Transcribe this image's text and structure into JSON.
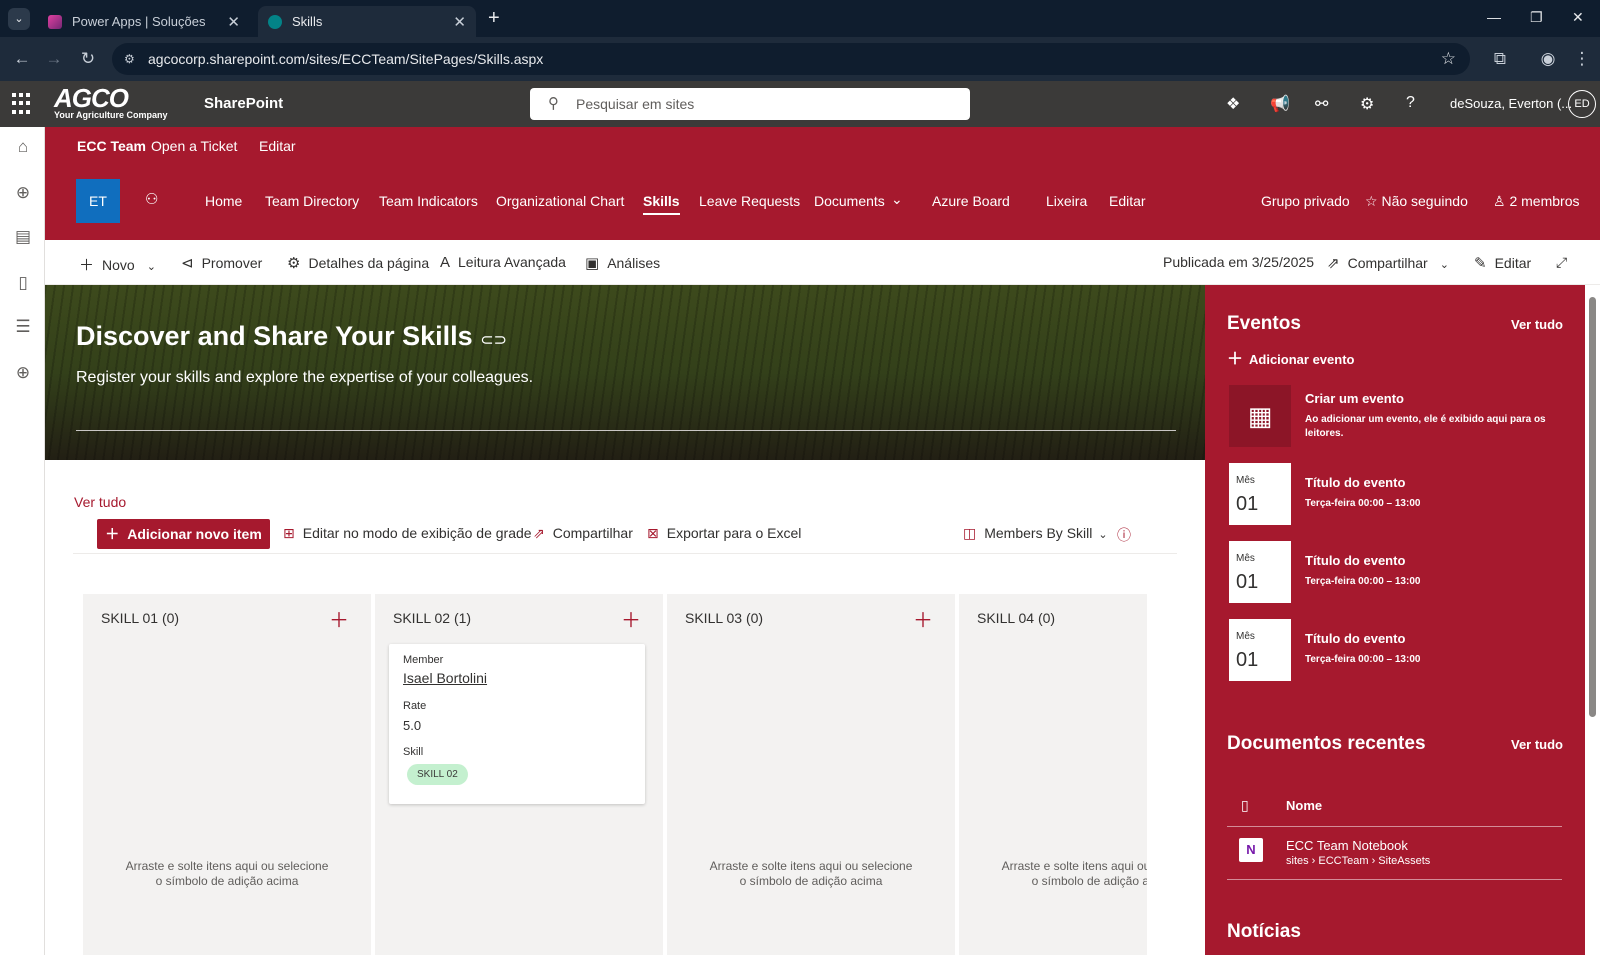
{
  "browser": {
    "tabs": [
      {
        "title": "Power Apps | Soluções",
        "active": false
      },
      {
        "title": "Skills",
        "active": true
      }
    ],
    "url": "agcocorp.sharepoint.com/sites/ECCTeam/SitePages/Skills.aspx"
  },
  "suite": {
    "logo": "AGCO",
    "tagline": "Your Agriculture Company",
    "app": "SharePoint",
    "search_placeholder": "Pesquisar em sites",
    "user": "deSouza, Everton (...",
    "initials": "ED"
  },
  "hub": {
    "items": [
      "ECC Team",
      "Open a Ticket",
      "Editar"
    ]
  },
  "site": {
    "initials": "ET",
    "nav": [
      "Home",
      "Team Directory",
      "Team Indicators",
      "Organizational Chart",
      "Skills",
      "Leave Requests",
      "Documents",
      "Azure Board",
      "Lixeira",
      "Editar"
    ],
    "current": "Skills",
    "privacy": "Grupo privado",
    "follow": "Não seguindo",
    "members": "2 membros"
  },
  "commandbar": {
    "new": "Novo",
    "promote": "Promover",
    "details": "Detalhes da página",
    "reader": "Leitura Avançada",
    "analytics": "Análises",
    "published": "Publicada em 3/25/2025",
    "share": "Compartilhar",
    "edit": "Editar"
  },
  "hero": {
    "title": "Discover and Share Your Skills",
    "subtitle": "Register your skills and explore the expertise of your colleagues."
  },
  "list": {
    "see_all": "Ver tudo",
    "add_item": "Adicionar novo item",
    "grid_edit": "Editar no modo de exibição de grade",
    "share": "Compartilhar",
    "export": "Exportar para o Excel",
    "view": "Members By Skill",
    "empty_text": "Arraste e solte itens aqui ou selecione o símbolo de adição acima",
    "columns": [
      {
        "title": "SKILL 01 (0)",
        "cards": []
      },
      {
        "title": "SKILL 02 (1)",
        "cards": [
          {
            "member_label": "Member",
            "member": "Isael Bortolini",
            "rate_label": "Rate",
            "rate": "5.0",
            "skill_label": "Skill",
            "skill": "SKILL 02"
          }
        ]
      },
      {
        "title": "SKILL 03 (0)",
        "cards": []
      },
      {
        "title": "SKILL 04 (0)",
        "cards": []
      }
    ]
  },
  "events": {
    "title": "Eventos",
    "see_all": "Ver tudo",
    "add": "Adicionar evento",
    "create_title": "Criar um evento",
    "create_desc": "Ao adicionar um evento, ele é exibido aqui para os leitores.",
    "items": [
      {
        "month": "Mês",
        "day": "01",
        "title": "Título do evento",
        "time": "Terça-feira 00:00 – 13:00"
      },
      {
        "month": "Mês",
        "day": "01",
        "title": "Título do evento",
        "time": "Terça-feira 00:00 – 13:00"
      },
      {
        "month": "Mês",
        "day": "01",
        "title": "Título do evento",
        "time": "Terça-feira 00:00 – 13:00"
      }
    ]
  },
  "documents": {
    "title": "Documentos recentes",
    "see_all": "Ver tudo",
    "name_header": "Nome",
    "items": [
      {
        "name": "ECC Team Notebook",
        "path": "sites › ECCTeam › SiteAssets"
      }
    ]
  },
  "news": {
    "title": "Notícias"
  }
}
